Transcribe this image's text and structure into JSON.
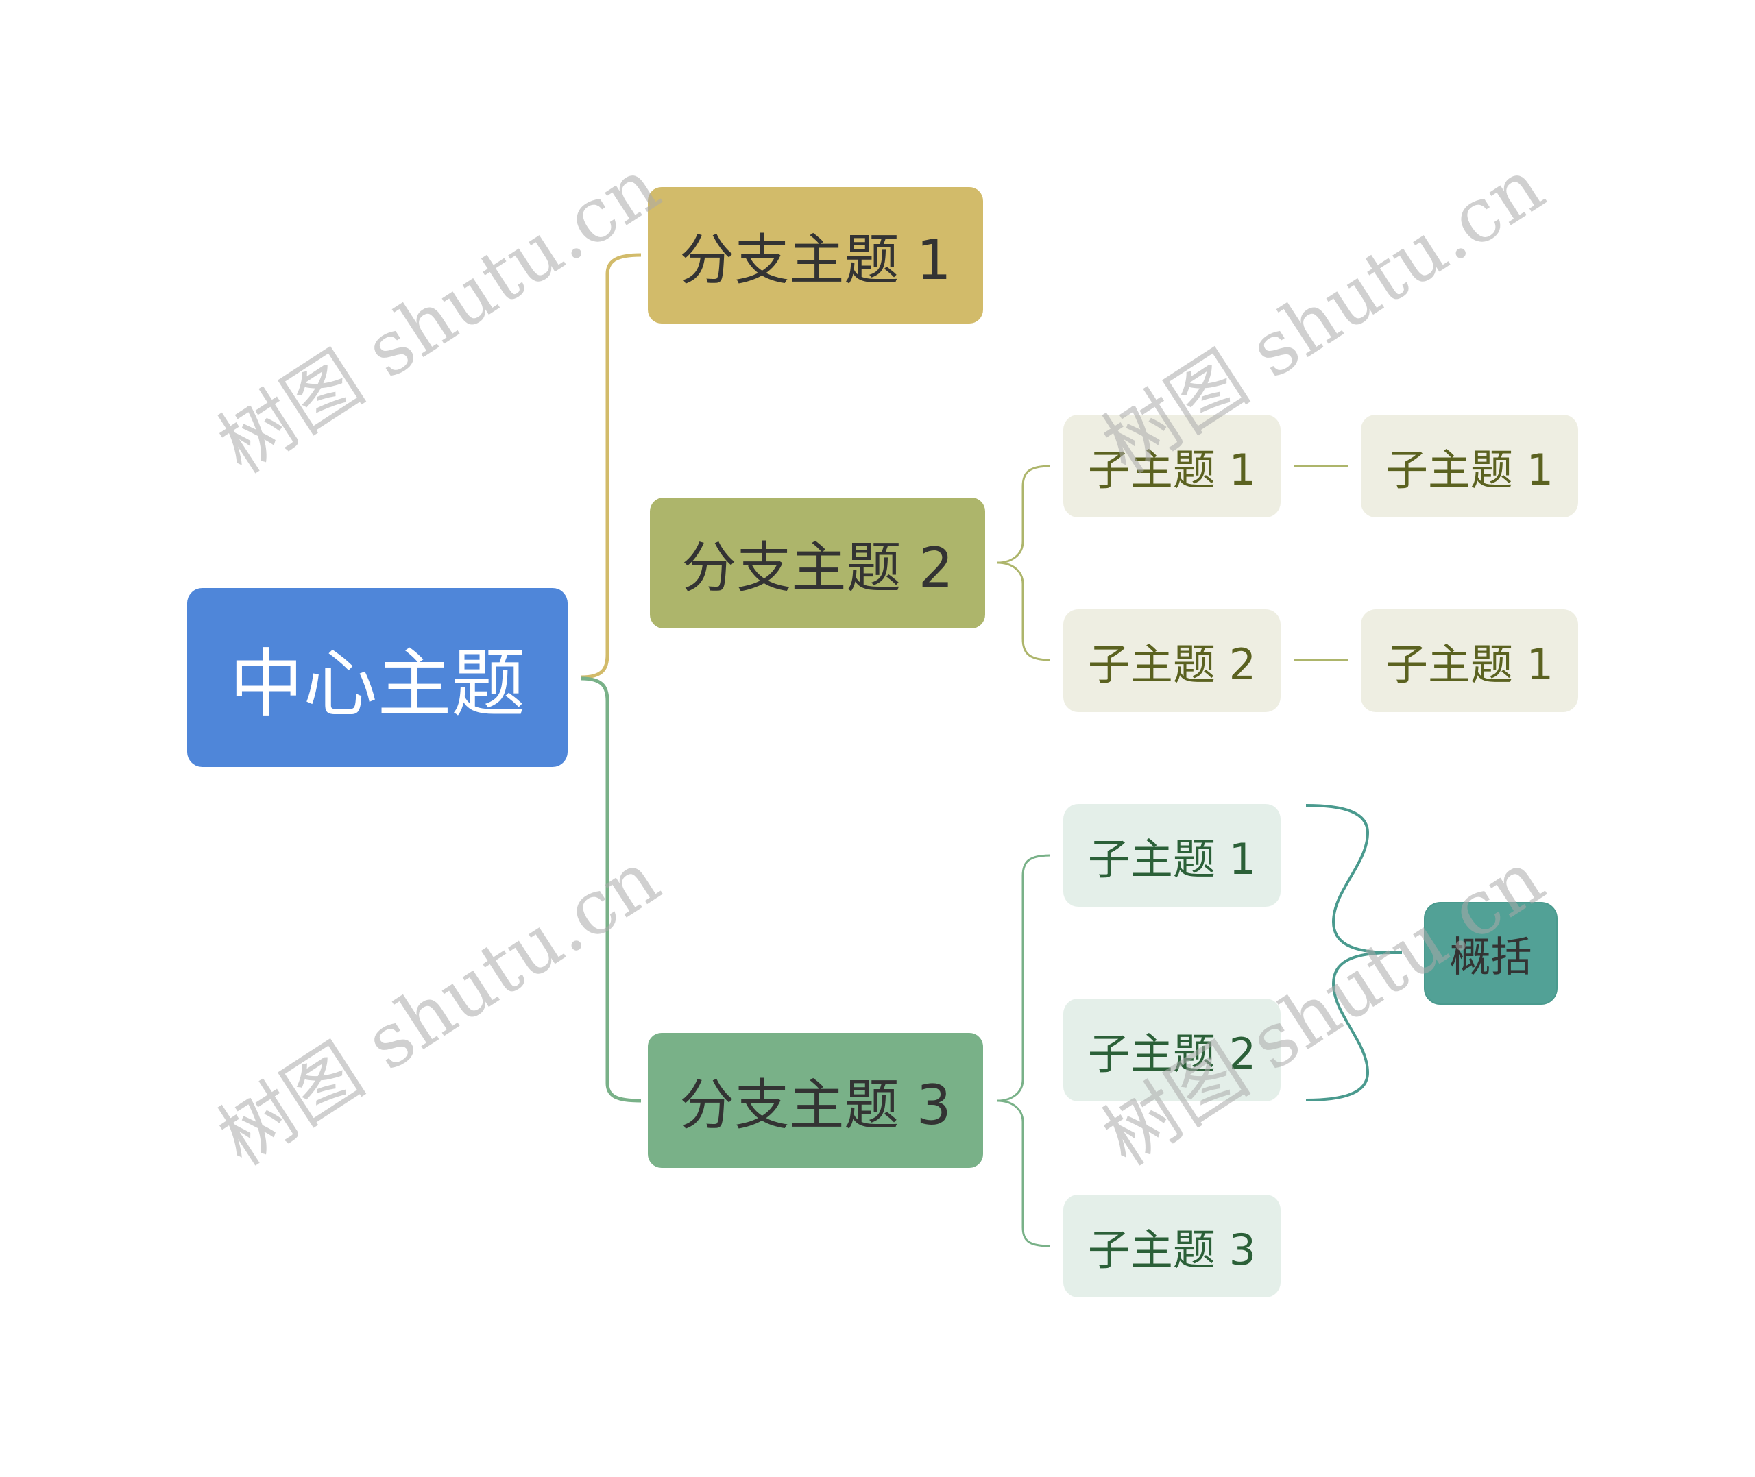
{
  "diagram": {
    "central": {
      "label": "中心主题",
      "color": "#4f86d9"
    },
    "branches": [
      {
        "label": "分支主题 1",
        "color": "#d2bb6a",
        "children": []
      },
      {
        "label": "分支主题 2",
        "color": "#adb56b",
        "children": [
          {
            "label": "子主题 1",
            "children": [
              {
                "label": "子主题 1"
              }
            ]
          },
          {
            "label": "子主题 2",
            "children": [
              {
                "label": "子主题 1"
              }
            ]
          }
        ]
      },
      {
        "label": "分支主题 3",
        "color": "#79b188",
        "children": [
          {
            "label": "子主题 1"
          },
          {
            "label": "子主题 2"
          },
          {
            "label": "子主题 3"
          }
        ]
      }
    ],
    "summary": {
      "label": "概括",
      "color": "#52a196",
      "covers": "分支主题 3: 子主题 1 – 子主题 2"
    }
  },
  "watermark": "树图 shutu.cn"
}
